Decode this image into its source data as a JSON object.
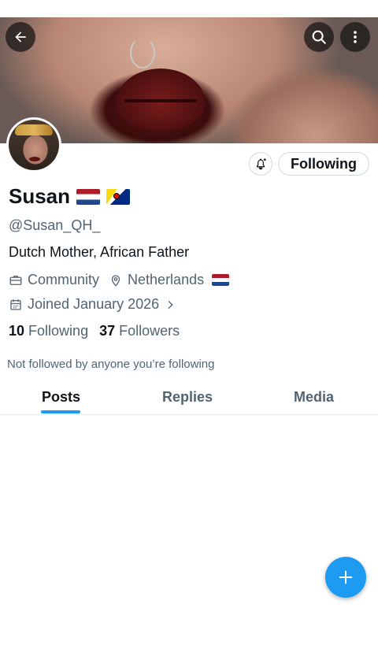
{
  "header": {
    "back_icon": "arrow-left-icon",
    "search_icon": "search-icon",
    "more_icon": "more-vertical-icon"
  },
  "profile": {
    "name": "Susan",
    "name_flags": [
      "netherlands-flag",
      "bonaire-flag"
    ],
    "handle": "@Susan_QH_",
    "bio": "Dutch Mother, African Father",
    "category": "Community",
    "location": "Netherlands",
    "location_flag": "netherlands-flag",
    "joined": "Joined January 2026",
    "following_count": "10",
    "following_label": "Following",
    "followers_count": "37",
    "followers_label": "Followers",
    "not_followed_text": "Not followed by anyone you’re following"
  },
  "actions": {
    "notify_icon": "bell-plus-icon",
    "following_button": "Following"
  },
  "tabs": [
    {
      "label": "Posts",
      "active": true
    },
    {
      "label": "Replies",
      "active": false
    },
    {
      "label": "Media",
      "active": false
    }
  ],
  "fab": {
    "icon": "plus-icon"
  },
  "colors": {
    "accent": "#1d9bf0",
    "text_primary": "#0f1419",
    "text_secondary": "#536471",
    "border": "#cfd9de"
  }
}
